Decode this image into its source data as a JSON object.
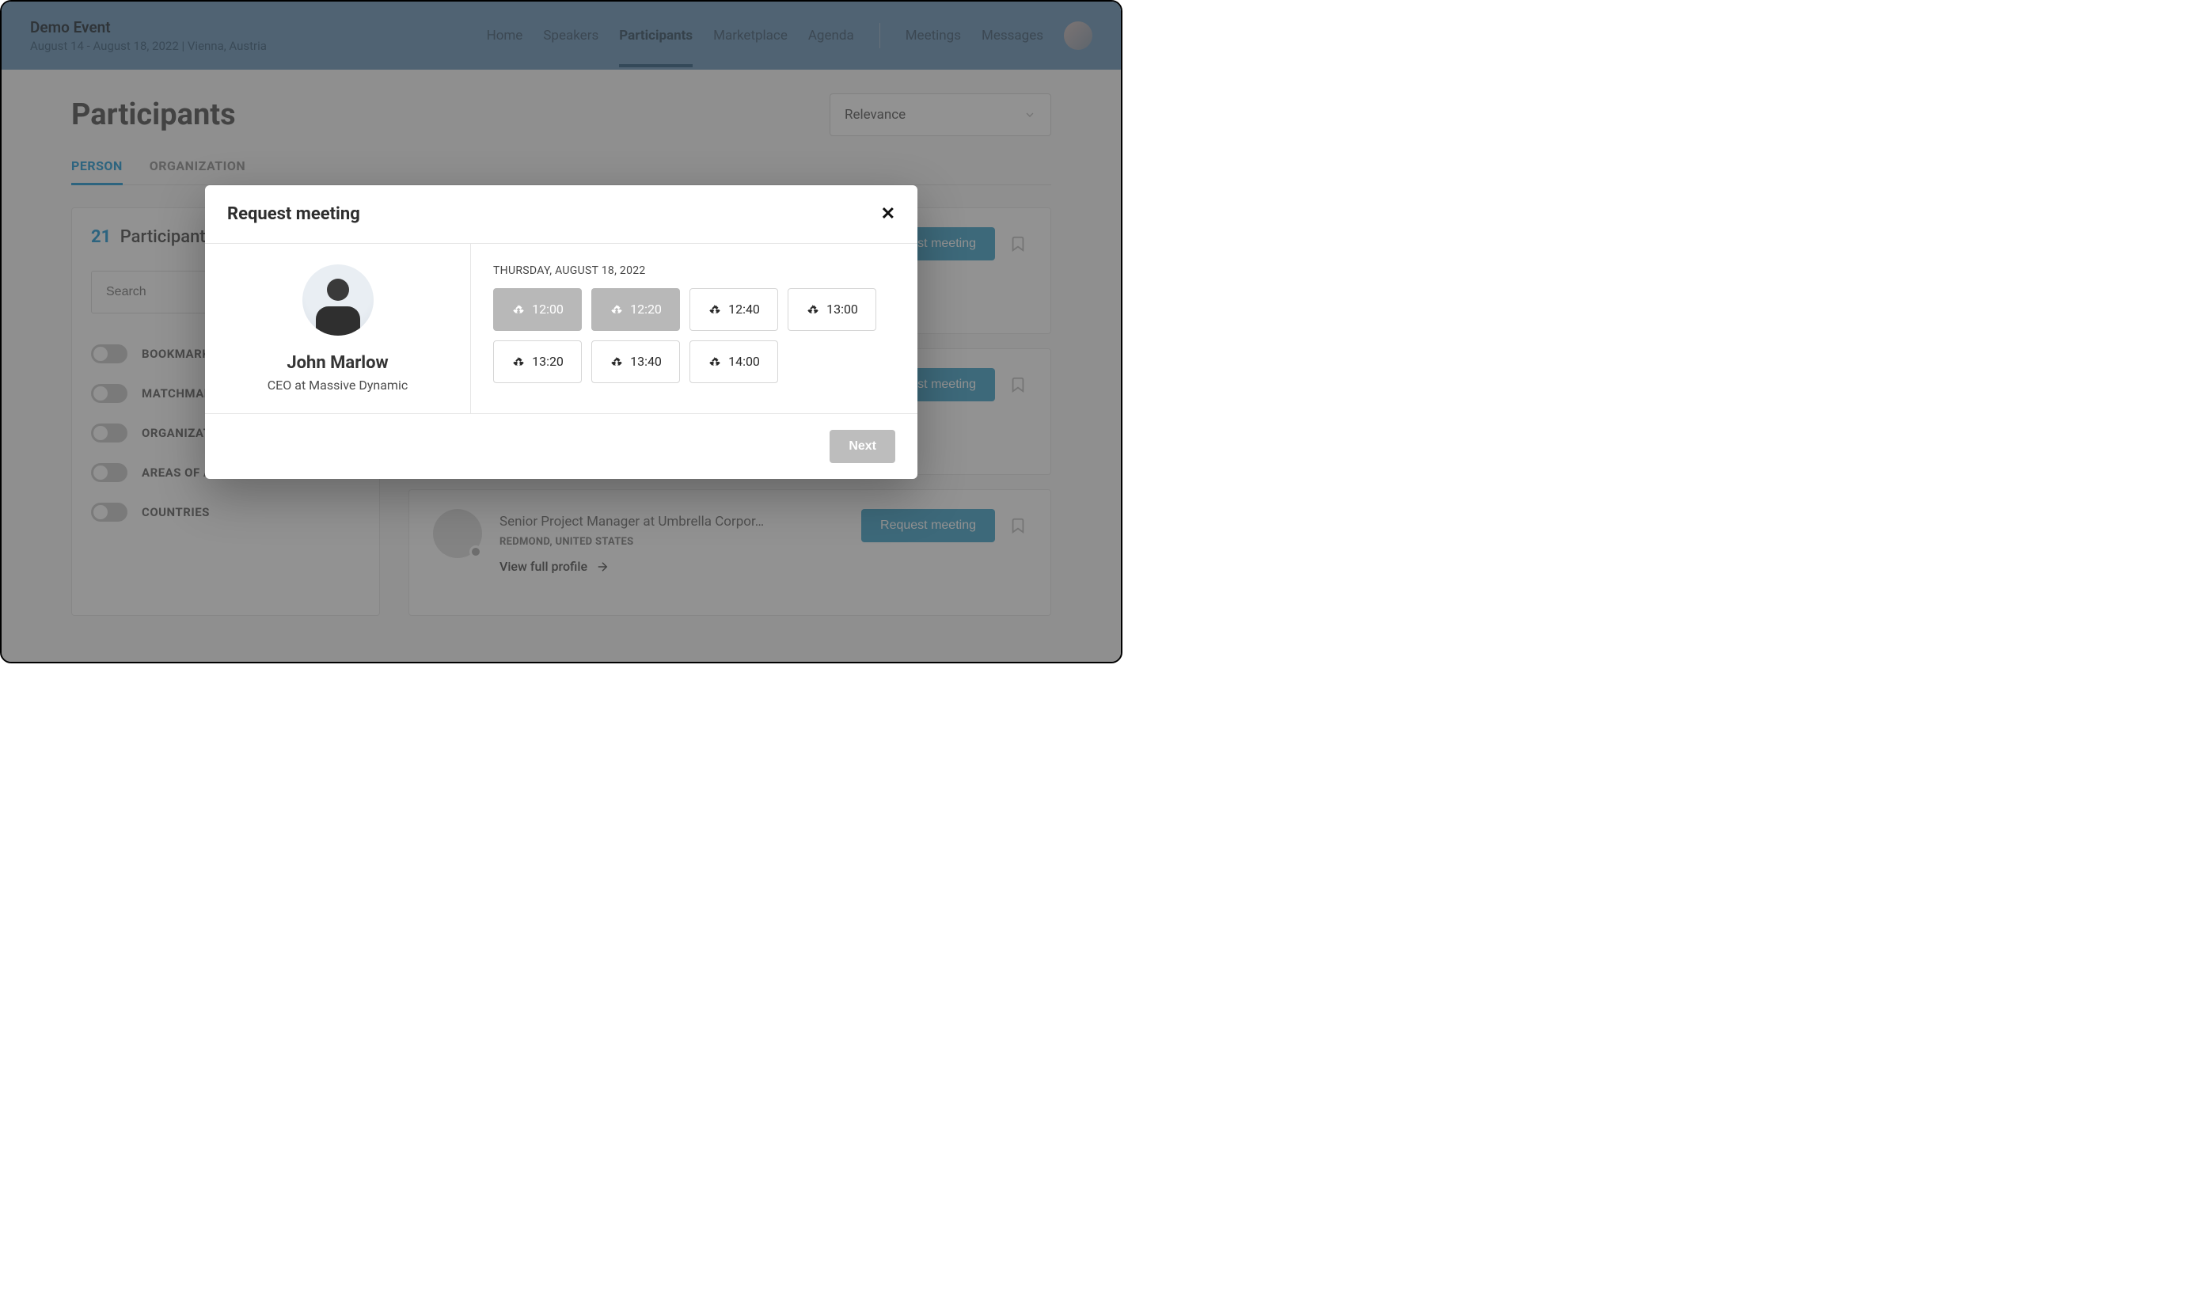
{
  "header": {
    "event_title": "Demo Event",
    "event_subtitle": "August 14 - August 18, 2022 | Vienna, Austria",
    "nav": {
      "home": "Home",
      "speakers": "Speakers",
      "participants": "Participants",
      "marketplace": "Marketplace",
      "agenda": "Agenda",
      "meetings": "Meetings",
      "messages": "Messages"
    }
  },
  "page": {
    "title": "Participants",
    "sort_label": "Relevance",
    "tabs": {
      "person": "PERSON",
      "organization": "ORGANIZATION"
    }
  },
  "sidebar": {
    "count": "21",
    "count_label": "Participants",
    "search_placeholder": "Search",
    "filters": {
      "bookmarked": "BOOKMARKED",
      "matchmaking": "MATCHMAKING",
      "organization": "ORGANIZATION",
      "areas": "AREAS OF ACTIVITY",
      "countries": "COUNTRIES"
    }
  },
  "cards": {
    "request_button": "Request meeting",
    "view_profile": "View full profile",
    "card3_role": "Senior Project Manager at Umbrella Corpor…",
    "card3_location": "REDMOND, UNITED STATES"
  },
  "modal": {
    "title": "Request meeting",
    "person_name": "John Marlow",
    "person_role": "CEO at Massive Dynamic",
    "date_label": "THURSDAY, AUGUST 18, 2022",
    "slots": [
      {
        "time": "12:00",
        "disabled": true
      },
      {
        "time": "12:20",
        "disabled": true
      },
      {
        "time": "12:40",
        "disabled": false
      },
      {
        "time": "13:00",
        "disabled": false
      },
      {
        "time": "13:20",
        "disabled": false
      },
      {
        "time": "13:40",
        "disabled": false
      },
      {
        "time": "14:00",
        "disabled": false
      }
    ],
    "next_label": "Next"
  }
}
